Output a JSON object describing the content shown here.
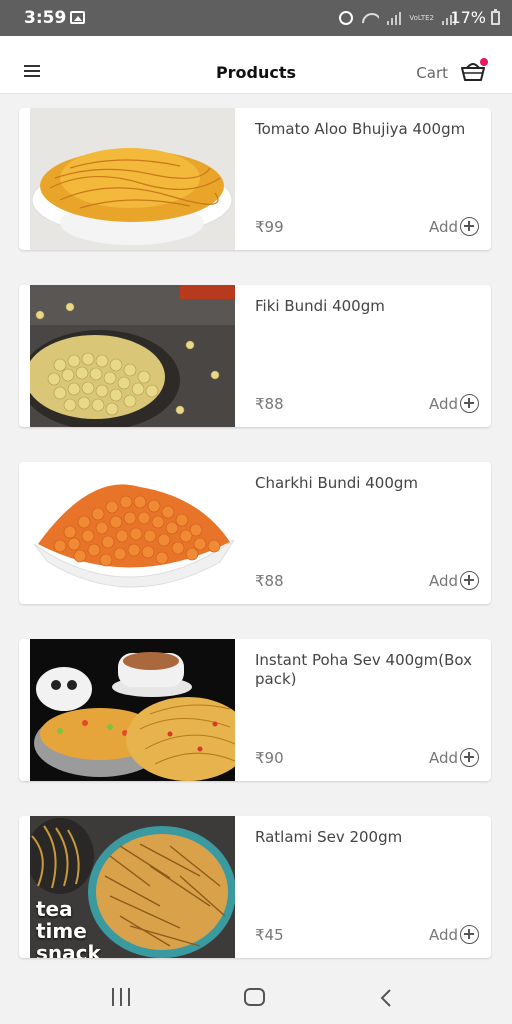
{
  "status_bar": {
    "time": "3:59",
    "battery": "17%",
    "network": "VoLTE2"
  },
  "header": {
    "title": "Products",
    "cart_label": "Cart",
    "cart_badge_color": "#e8175d"
  },
  "products": [
    {
      "name": "Tomato Aloo Bhujiya 400gm",
      "price": "₹99",
      "add_label": "Add"
    },
    {
      "name": "Fiki Bundi 400gm",
      "price": "₹88",
      "add_label": "Add"
    },
    {
      "name": "Charkhi Bundi 400gm",
      "price": "₹88",
      "add_label": "Add"
    },
    {
      "name": "Instant Poha Sev 400gm(Box pack)",
      "price": "₹90",
      "add_label": "Add"
    },
    {
      "name": "Ratlami Sev 200gm",
      "price": "₹45",
      "add_label": "Add",
      "image_caption": [
        "tea",
        "time",
        "snack"
      ]
    }
  ]
}
